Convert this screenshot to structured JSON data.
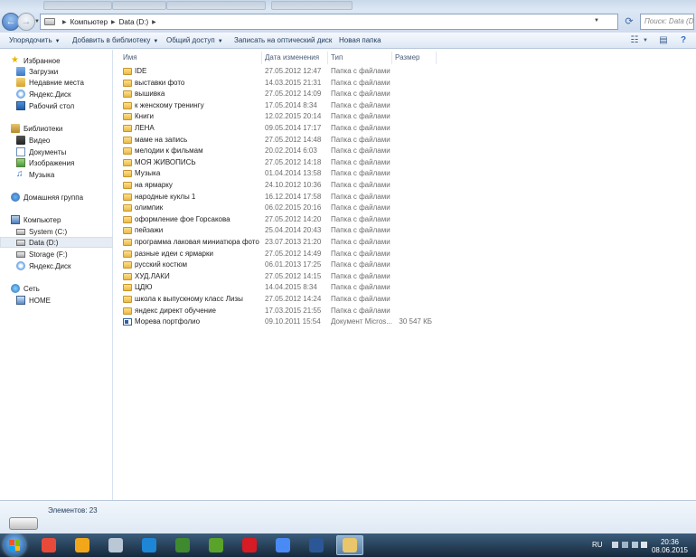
{
  "window": {
    "breadcrumb": [
      "Компьютер",
      "Data (D:)"
    ],
    "search_placeholder": "Поиск: Data (D:)"
  },
  "toolbar": {
    "organize": "Упорядочить",
    "add_to_library": "Добавить в библиотеку",
    "share": "Общий доступ",
    "burn": "Записать на оптический диск",
    "new_folder": "Новая папка"
  },
  "nav": {
    "favorites": "Избранное",
    "downloads": "Загрузки",
    "recent": "Недавние места",
    "yandex_disk": "Яндекс.Диск",
    "desktop": "Рабочий стол",
    "libraries": "Библиотеки",
    "video": "Видео",
    "documents": "Документы",
    "images": "Изображения",
    "music": "Музыка",
    "homegroup": "Домашняя группа",
    "computer": "Компьютер",
    "system": "System (C:)",
    "data": "Data (D:)",
    "storage": "Storage (F:)",
    "yandex_disk2": "Яндекс.Диск",
    "network": "Сеть",
    "home": "HOME"
  },
  "columns": {
    "name": "Имя",
    "date": "Дата изменения",
    "type": "Тип",
    "size": "Размер"
  },
  "files": [
    {
      "name": "IDE",
      "date": "27.05.2012 12:47",
      "type": "Папка с файлами",
      "size": "",
      "kind": "folder"
    },
    {
      "name": "выставки фото",
      "date": "14.03.2015 21:31",
      "type": "Папка с файлами",
      "size": "",
      "kind": "folder"
    },
    {
      "name": "вышивка",
      "date": "27.05.2012 14:09",
      "type": "Папка с файлами",
      "size": "",
      "kind": "folder"
    },
    {
      "name": "к женскому тренингу",
      "date": "17.05.2014 8:34",
      "type": "Папка с файлами",
      "size": "",
      "kind": "folder"
    },
    {
      "name": "Книги",
      "date": "12.02.2015 20:14",
      "type": "Папка с файлами",
      "size": "",
      "kind": "folder"
    },
    {
      "name": "ЛЕНА",
      "date": "09.05.2014 17:17",
      "type": "Папка с файлами",
      "size": "",
      "kind": "folder"
    },
    {
      "name": "маме на запись",
      "date": "27.05.2012 14:48",
      "type": "Папка с файлами",
      "size": "",
      "kind": "folder"
    },
    {
      "name": "мелодии к фильмам",
      "date": "20.02.2014 6:03",
      "type": "Папка с файлами",
      "size": "",
      "kind": "folder"
    },
    {
      "name": "МОЯ ЖИВОПИСЬ",
      "date": "27.05.2012 14:18",
      "type": "Папка с файлами",
      "size": "",
      "kind": "folder"
    },
    {
      "name": "Музыка",
      "date": "01.04.2014 13:58",
      "type": "Папка с файлами",
      "size": "",
      "kind": "folder"
    },
    {
      "name": "на ярмарку",
      "date": "24.10.2012 10:36",
      "type": "Папка с файлами",
      "size": "",
      "kind": "folder"
    },
    {
      "name": "народные куклы 1",
      "date": "16.12.2014 17:58",
      "type": "Папка с файлами",
      "size": "",
      "kind": "folder"
    },
    {
      "name": "олимпик",
      "date": "06.02.2015 20:16",
      "type": "Папка с файлами",
      "size": "",
      "kind": "folder"
    },
    {
      "name": "оформление фое Горсакова",
      "date": "27.05.2012 14:20",
      "type": "Папка с файлами",
      "size": "",
      "kind": "folder"
    },
    {
      "name": "пейзажи",
      "date": "25.04.2014 20:43",
      "type": "Папка с файлами",
      "size": "",
      "kind": "folder"
    },
    {
      "name": "программа лаковая миниатюра фото",
      "date": "23.07.2013 21:20",
      "type": "Папка с файлами",
      "size": "",
      "kind": "folder"
    },
    {
      "name": "разные идеи с ярмарки",
      "date": "27.05.2012 14:49",
      "type": "Папка с файлами",
      "size": "",
      "kind": "folder"
    },
    {
      "name": "русский костюм",
      "date": "06.01.2013 17:25",
      "type": "Папка с файлами",
      "size": "",
      "kind": "folder"
    },
    {
      "name": "ХУД.ЛАКИ",
      "date": "27.05.2012 14:15",
      "type": "Папка с файлами",
      "size": "",
      "kind": "folder"
    },
    {
      "name": "ЦДЮ",
      "date": "14.04.2015 8:34",
      "type": "Папка с файлами",
      "size": "",
      "kind": "folder"
    },
    {
      "name": "школа к выпускному класс Лизы",
      "date": "27.05.2012 14:24",
      "type": "Папка с файлами",
      "size": "",
      "kind": "folder"
    },
    {
      "name": "яндекс директ обучение",
      "date": "17.03.2015 21:55",
      "type": "Папка с файлами",
      "size": "",
      "kind": "folder"
    },
    {
      "name": "Морева портфолио",
      "date": "09.10.2011 15:54",
      "type": "Документ Micros...",
      "size": "30 547 КБ",
      "kind": "word"
    }
  ],
  "status": {
    "items_count": "Элементов: 23"
  },
  "taskbar": {
    "lang": "RU",
    "time": "20:36",
    "date": "08.06.2015",
    "apps": [
      {
        "name": "colorful-x-icon",
        "color": "#e84a3a"
      },
      {
        "name": "aimp-icon",
        "color": "#f2a71b"
      },
      {
        "name": "calculator-icon",
        "color": "#b9c7d6"
      },
      {
        "name": "maxthon-icon",
        "color": "#1e86d6"
      },
      {
        "name": "green-x-icon",
        "color": "#3f8a2f"
      },
      {
        "name": "utorrent-icon",
        "color": "#5aa32b"
      },
      {
        "name": "opera-icon",
        "color": "#d61b24"
      },
      {
        "name": "chrome-icon",
        "color": "#4a8af4"
      },
      {
        "name": "word-icon",
        "color": "#2b5797"
      },
      {
        "name": "explorer-icon",
        "color": "#e9c66a"
      }
    ]
  }
}
